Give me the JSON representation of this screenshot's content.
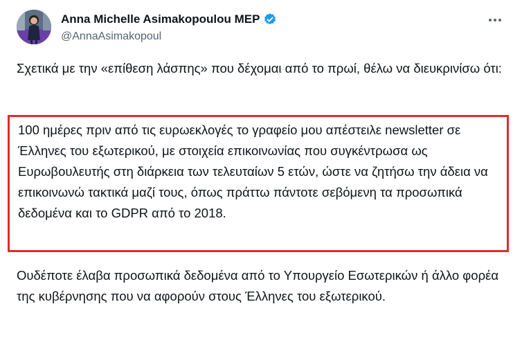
{
  "author": {
    "display_name": "Anna Michelle Asimakopoulou MEP",
    "handle": "@AnnaAsimakopoul",
    "verified": true,
    "avatar_icon": "profile-photo"
  },
  "tweet": {
    "paragraph_1": "Σχετικά με την «επίθεση λάσπης» που δέχομαι από το πρωί, θέλω να διευκρινίσω ότι:",
    "paragraph_2": "100 ημέρες πριν από τις ευρωεκλογές το γραφείο μου απέστειλε newsletter σε Έλληνες του εξωτερικού, με στοιχεία επικοινωνίας που συγκέντρωσα ως Ευρωβουλευτής στη διάρκεια των τελευταίων 5 ετών, ώστε να ζητήσω την άδεια να επικοινωνώ τακτικά μαζί τους, όπως πράττω πάντοτε σεβόμενη τα προσωπικά δεδομένα και το GDPR από το 2018.",
    "paragraph_3": "Ουδέποτε έλαβα προσωπικά δεδομένα από το Υπουργείο Εσωτερικών ή άλλο φορέα της κυβέρνησης που να αφορούν στους Έλληνες του εξωτερικού."
  },
  "icons": {
    "verified": "verified-badge-icon",
    "more": "more-options-icon"
  },
  "colors": {
    "verified_blue": "#1d9bf0",
    "highlight_red": "#e02b2b",
    "text": "#0f1419",
    "secondary_text": "#536471"
  }
}
